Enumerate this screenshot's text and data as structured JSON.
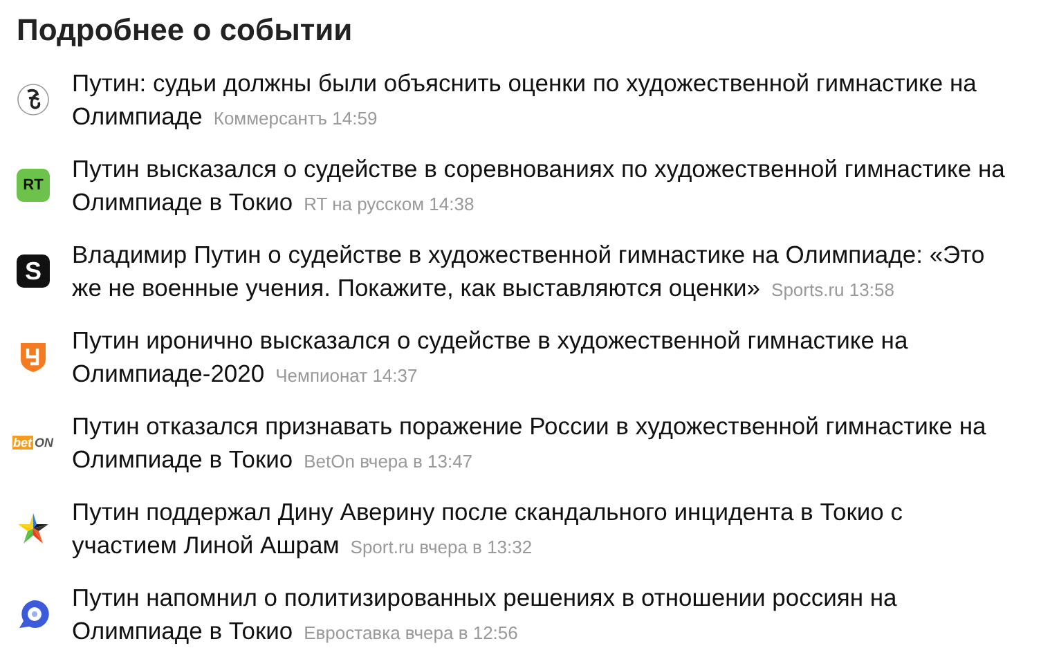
{
  "title": "Подробнее о событии",
  "items": [
    {
      "headline": "Путин: судьи должны были объяснить оценки по художественной гимнастике на Олимпиаде",
      "source": "Коммерсантъ",
      "time": "14:59",
      "kind": "kommersant"
    },
    {
      "headline": "Путин высказался о судействе в соревнованиях по художественной гимнастике на Олимпиаде в Токио",
      "source": "RT на русском",
      "time": "14:38",
      "kind": "rt",
      "logo_text": "RT"
    },
    {
      "headline": "Владимир Путин о судействе в художественной гимнастике на Олимпиаде: «Это же не военные учения. Покажите, как выставляются оценки»",
      "source": "Sports.ru",
      "time": "13:58",
      "kind": "sports",
      "logo_text": "S"
    },
    {
      "headline": "Путин иронично высказался о судействе в художественной гимнастике на Олимпиаде-2020",
      "source": "Чемпионат",
      "time": "14:37",
      "kind": "championat"
    },
    {
      "headline": "Путин отказался признавать поражение России в художественной гимнастике на Олимпиаде в Токио",
      "source": "BetOn",
      "time": "вчера в 13:47",
      "kind": "beton",
      "logo_text": "bet",
      "logo_text_2": "ON"
    },
    {
      "headline": "Путин поддержал Дину Аверину после скандального инцидента в Токио с участием Линой Ашрам",
      "source": "Sport.ru",
      "time": "вчера в 13:32",
      "kind": "star"
    },
    {
      "headline": "Путин напомнил о политизированных решениях в отношении россиян на Олимпиаде в Токио",
      "source": "Евроставка",
      "time": "вчера в 12:56",
      "kind": "evrostavka"
    }
  ]
}
